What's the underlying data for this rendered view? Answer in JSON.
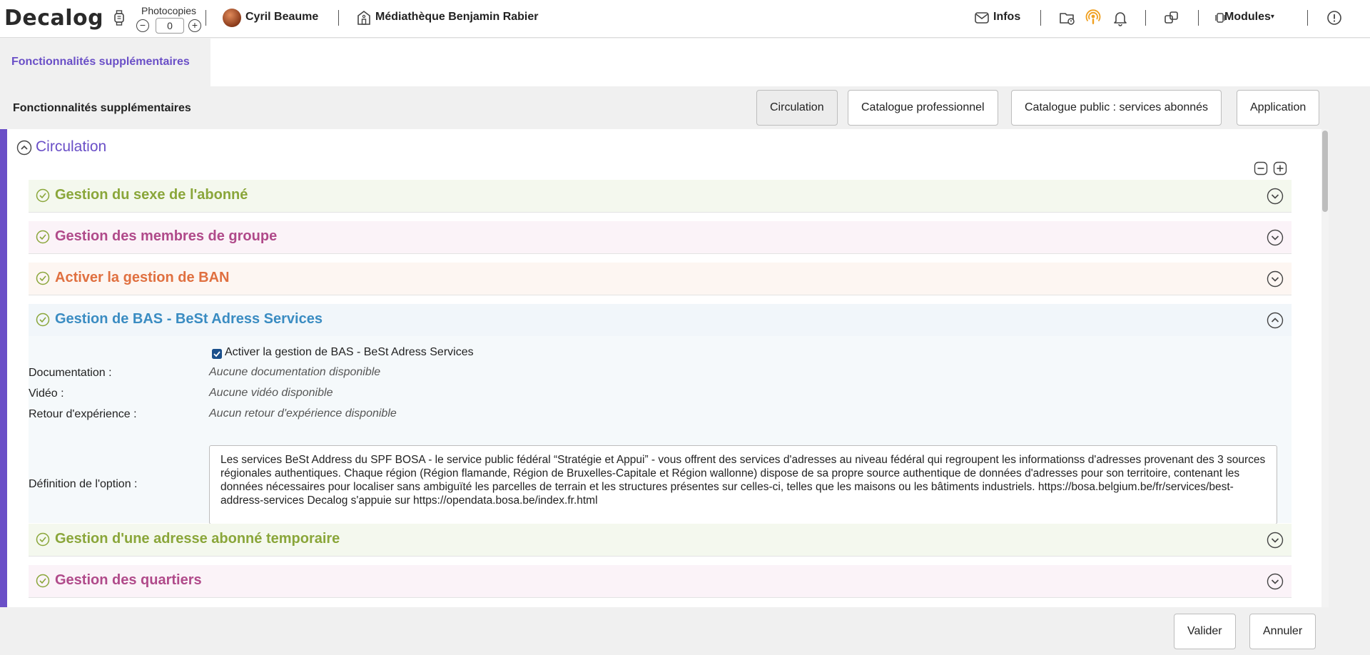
{
  "header": {
    "logo": "Decalog",
    "photocopies_label": "Photocopies",
    "photocopies_value": "0",
    "user_name": "Cyril Beaume",
    "library_name": "Médiathèque Benjamin Rabier",
    "infos_label": "Infos",
    "modules_label": "Modules",
    "icons": [
      "watch-icon",
      "mail-icon",
      "folder-icon",
      "podcast-icon",
      "bell-icon",
      "windows-icon",
      "modules-icon",
      "info-icon"
    ],
    "colors": {
      "podcast": "#f0a020"
    }
  },
  "tabs": {
    "active_label": "Fonctionnalités supplémentaires"
  },
  "section": {
    "title": "Fonctionnalités supplémentaires",
    "filters": [
      "Circulation",
      "Catalogue professionnel",
      "Catalogue public : services abonnés",
      "Application"
    ],
    "active_filter": "Circulation"
  },
  "panel": {
    "group_title": "Circulation",
    "accent_color": "#6a4fc7",
    "features": [
      {
        "title": "Gestion du sexe de l'abonné",
        "color": "#8aa63a",
        "expanded": false
      },
      {
        "title": "Gestion des membres de groupe",
        "color": "#b04a8a",
        "expanded": false
      },
      {
        "title": "Activer la gestion de BAN",
        "color": "#e07040",
        "expanded": false
      },
      {
        "title": "Gestion de BAS - BeSt Adress Services",
        "color": "#3a8cc2",
        "expanded": true
      },
      {
        "title": "Gestion d'une adresse abonné temporaire",
        "color": "#8aa63a",
        "expanded": false
      },
      {
        "title": "Gestion des quartiers",
        "color": "#b04a8a",
        "expanded": false
      }
    ],
    "detail": {
      "checkbox_label": "Activer la gestion de BAS - BeSt Adress Services",
      "checkbox_checked": true,
      "documentation_label": "Documentation :",
      "documentation_value": "Aucune documentation disponible",
      "video_label": "Vidéo :",
      "video_value": "Aucune vidéo disponible",
      "retour_label": "Retour d'expérience :",
      "retour_value": "Aucun retour d'expérience disponible",
      "definition_label": "Définition de l'option :",
      "definition_text": "Les services BeSt Address du SPF BOSA - le service public fédéral “Stratégie et Appui” - vous offrent des services d'adresses au niveau fédéral qui regroupent les informationss d'adresses provenant des 3 sources régionales authentiques. Chaque région (Région flamande, Région de Bruxelles-Capitale et Région wallonne) dispose de sa propre source authentique de données d'adresses pour son territoire, contenant les données nécessaires pour localiser sans ambiguïté les parcelles de terrain et les structures présentes sur celles-ci, telles que les maisons ou les bâtiments industriels. https://bosa.belgium.be/fr/services/best-address-services Decalog s'appuie sur https://opendata.bosa.be/index.fr.html"
    }
  },
  "footer": {
    "validate_label": "Valider",
    "cancel_label": "Annuler"
  }
}
